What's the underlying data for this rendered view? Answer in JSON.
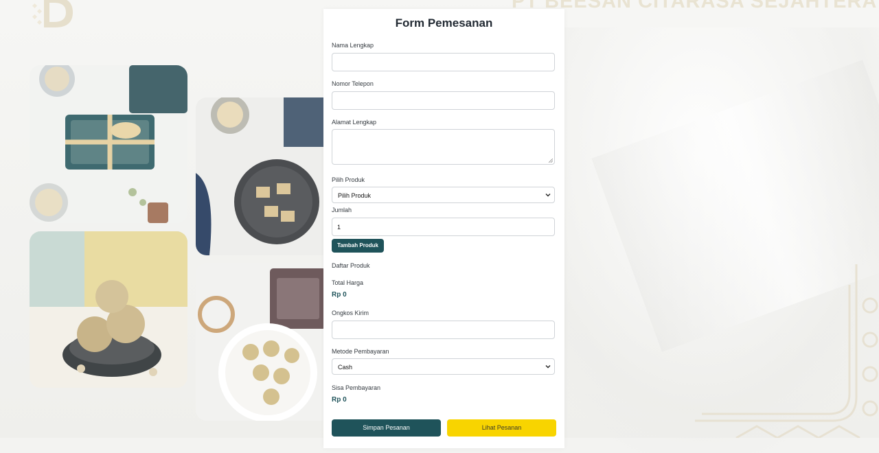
{
  "company": {
    "name": "PT BEESAN CITARASA SEJAHTERA"
  },
  "form": {
    "title": "Form Pemesanan",
    "full_name": {
      "label": "Nama Lengkap",
      "value": ""
    },
    "phone": {
      "label": "Nomor Telepon",
      "value": ""
    },
    "address": {
      "label": "Alamat Lengkap",
      "value": ""
    },
    "product": {
      "label": "Pilih Produk",
      "selected": "Pilih Produk"
    },
    "quantity": {
      "label": "Jumlah",
      "value": "1"
    },
    "add_product_label": "Tambah Produk",
    "product_list_label": "Daftar Produk",
    "total": {
      "label": "Total Harga",
      "value": "Rp 0"
    },
    "shipping": {
      "label": "Ongkos Kirim",
      "value": ""
    },
    "payment_method": {
      "label": "Metode Pembayaran",
      "selected": "Cash"
    },
    "remaining": {
      "label": "Sisa Pembayaran",
      "value": "Rp 0"
    },
    "save_label": "Simpan Pesanan",
    "view_label": "Lihat Pesanan"
  },
  "colors": {
    "primary": "#1f535a",
    "accent": "#f8d400",
    "background": "#f3f3f1"
  },
  "icons": {
    "select_arrow": "chevron-down-icon",
    "logo": "brand-logo-icon"
  }
}
